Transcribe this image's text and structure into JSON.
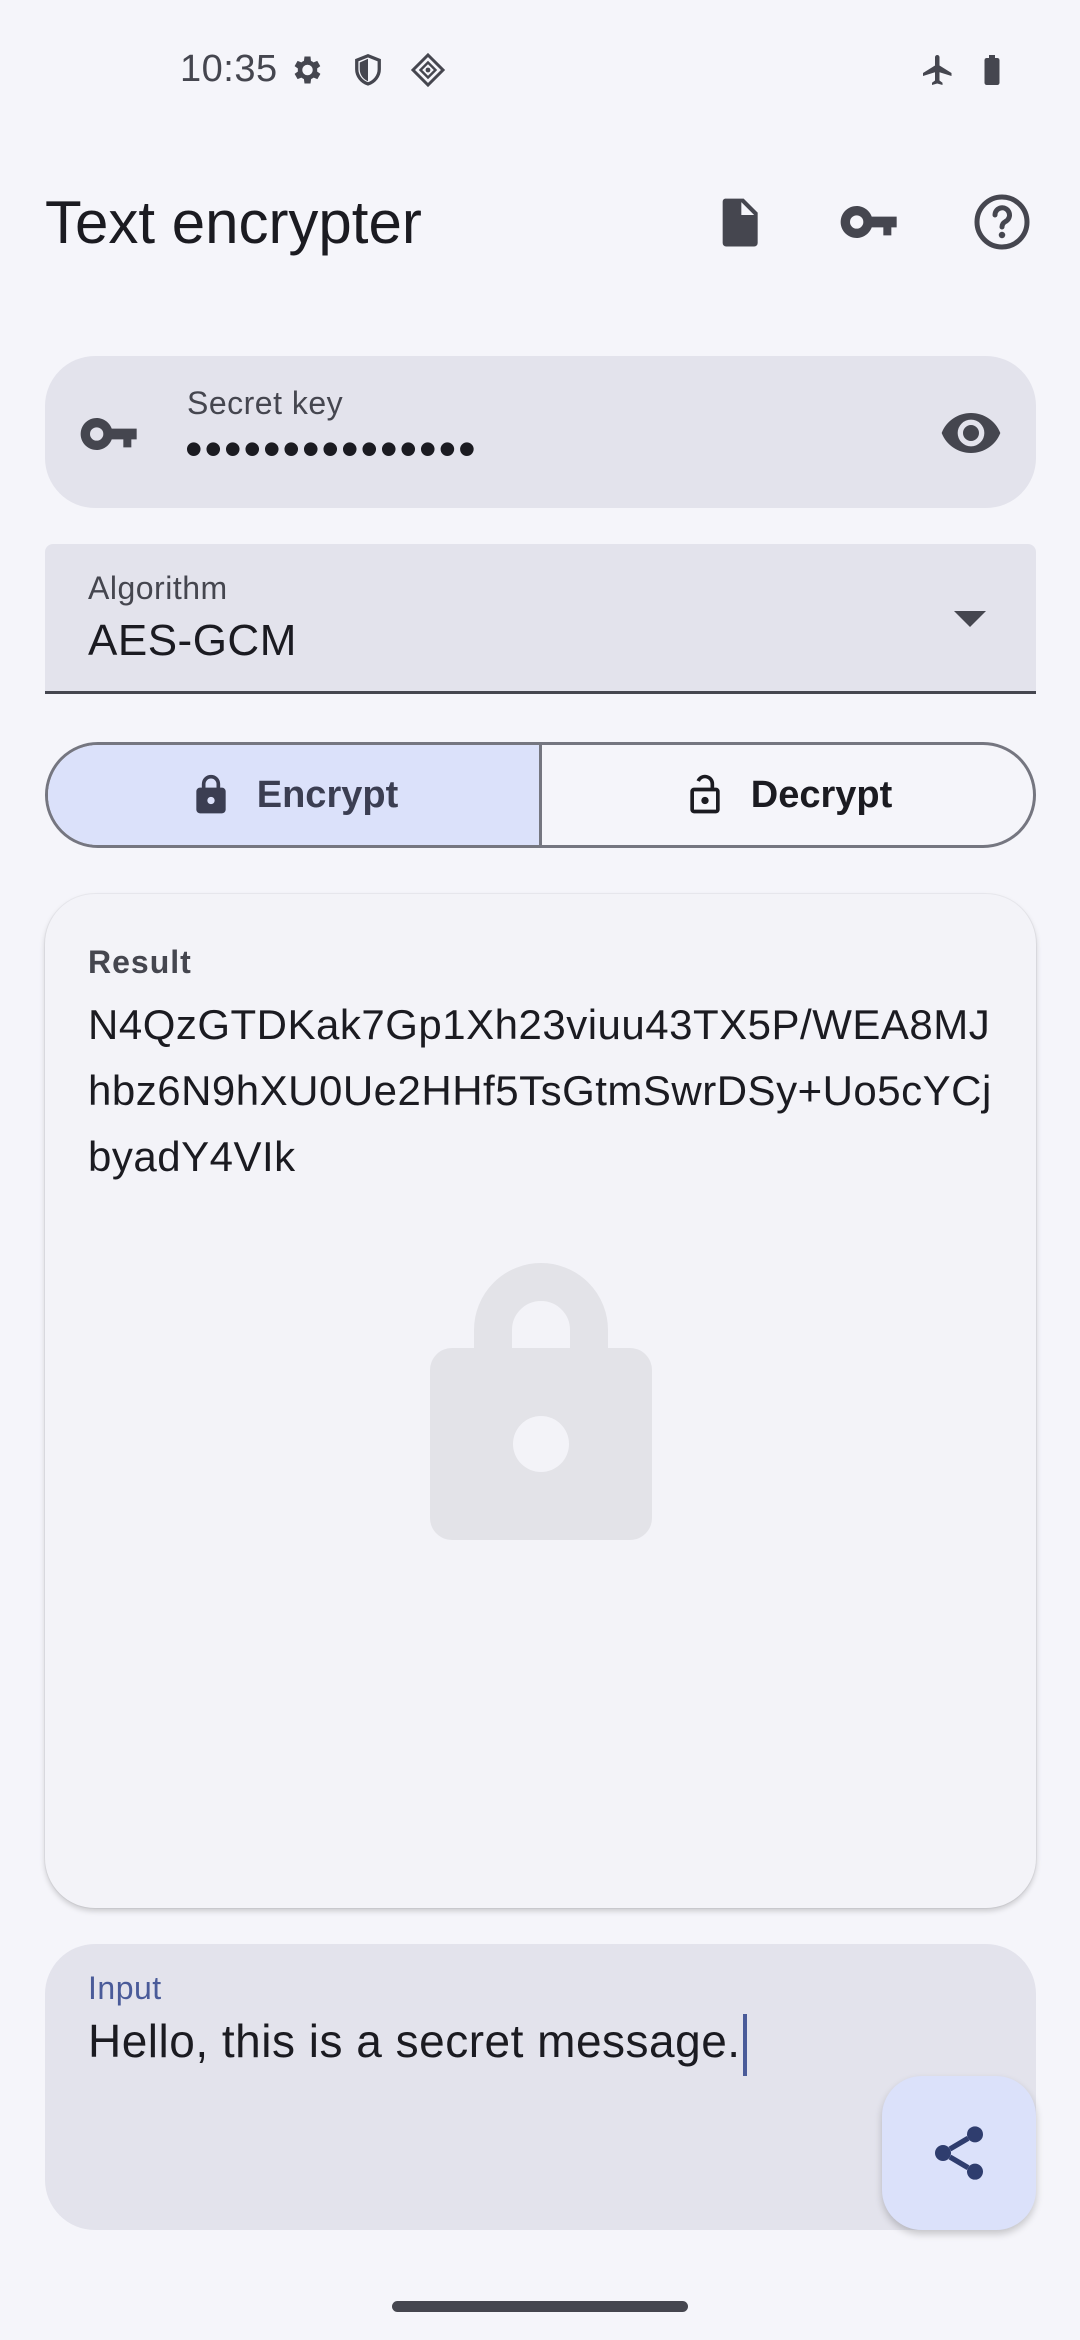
{
  "status_bar": {
    "time": "10:35",
    "icons": [
      "gear-icon",
      "shield-icon",
      "vpn-diamond-icon",
      "airplane-icon",
      "battery-icon"
    ]
  },
  "app_bar": {
    "title": "Text encrypter",
    "actions": [
      "file-icon",
      "key-icon",
      "help-icon"
    ]
  },
  "secret_key": {
    "label": "Secret key",
    "value": "•••••••••••••••",
    "leading_icon": "key-icon",
    "trailing_icon": "eye-icon"
  },
  "algorithm": {
    "label": "Algorithm",
    "value": "AES-GCM"
  },
  "mode": {
    "options": [
      {
        "label": "Encrypt",
        "icon": "lock-closed-icon",
        "selected": true
      },
      {
        "label": "Decrypt",
        "icon": "lock-open-icon",
        "selected": false
      }
    ]
  },
  "result": {
    "label": "Result",
    "text": "N4QzGTDKak7Gp1Xh23viuu43TX5P/WEA8MJhbz6N9hXU0Ue2HHf5TsGtmSwrDSy+Uo5cYCjbyadY4VIk"
  },
  "input": {
    "label": "Input",
    "value": "Hello, this is a secret message."
  },
  "fab": {
    "icon": "share-icon"
  },
  "colors": {
    "background": "#f5f5fa",
    "field": "#e3e3ec",
    "selected_segment": "#dbe1fa",
    "accent": "#4a5b99",
    "icon": "#45464f"
  }
}
